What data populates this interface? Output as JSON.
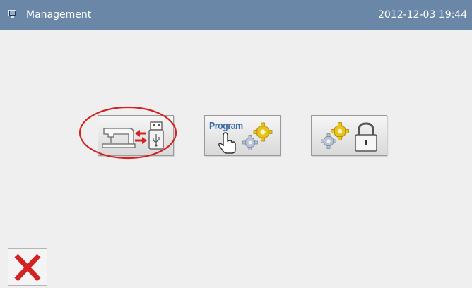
{
  "titlebar": {
    "title": "Management",
    "datetime": "2012-12-03  19:44",
    "icon": "monitor-icon"
  },
  "toolbar": {
    "buttons": [
      {
        "name": "machine-usb-transfer",
        "icons": [
          "sewing-machine-icon",
          "transfer-arrows-icon",
          "usb-drive-icon"
        ]
      },
      {
        "name": "program",
        "label": "Program",
        "icons": [
          "hand-pointer-icon",
          "gears-icon"
        ]
      },
      {
        "name": "settings-lock",
        "icons": [
          "gears-icon",
          "padlock-icon"
        ]
      }
    ]
  },
  "close": {
    "icon": "close-icon"
  },
  "colors": {
    "titlebar": "#6a87a8",
    "background": "#efefef",
    "accent_red": "#d42222",
    "program_text": "#3a6aa8",
    "gear_yellow": "#e9c21a"
  }
}
